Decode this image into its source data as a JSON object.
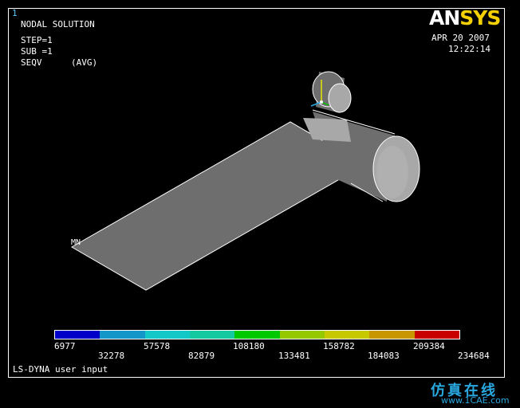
{
  "window": {
    "number": "1",
    "title": "NODAL SOLUTION",
    "step": "STEP=1",
    "sub": "SUB =1",
    "quantity": "SEQV",
    "avg": "(AVG)",
    "date": "APR 20 2007",
    "time": "12:22:14",
    "mn_label": "MN",
    "status": "LS-DYNA user input"
  },
  "logo": {
    "part1": "AN",
    "part2": "SYS"
  },
  "legend": {
    "colors": [
      "#0000c8",
      "#1496c8",
      "#14c8c8",
      "#14c8a0",
      "#00c800",
      "#96c800",
      "#c8c800",
      "#c89600",
      "#c80000"
    ],
    "values_top": [
      "6977",
      "57578",
      "108180",
      "158782",
      "209384"
    ],
    "values_bottom": [
      "32278",
      "82879",
      "133481",
      "184083",
      "234684"
    ]
  },
  "model": {
    "fill": "#6e6e6e",
    "highlight": "#a8a8a8",
    "edge": "#ffffff"
  },
  "watermark": {
    "text": "仿真在线",
    "url": "www.1CAE.com"
  }
}
